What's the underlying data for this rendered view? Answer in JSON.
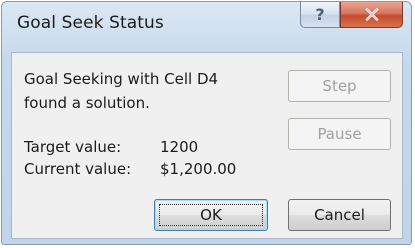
{
  "window": {
    "title": "Goal Seek Status",
    "help_glyph": "?",
    "close_icon": "close-icon"
  },
  "message": {
    "line1": "Goal Seeking with Cell D4",
    "line2": "found a solution."
  },
  "target": {
    "label": "Target value:",
    "value": "1200"
  },
  "current": {
    "label": "Current value:",
    "value": "$1,200.00"
  },
  "buttons": {
    "step": "Step",
    "pause": "Pause",
    "ok": "OK",
    "cancel": "Cancel"
  },
  "colors": {
    "close_red": "#c54b2f",
    "title_gradient_top": "#dbe7f4",
    "client_bg": "#f0f0f0"
  }
}
